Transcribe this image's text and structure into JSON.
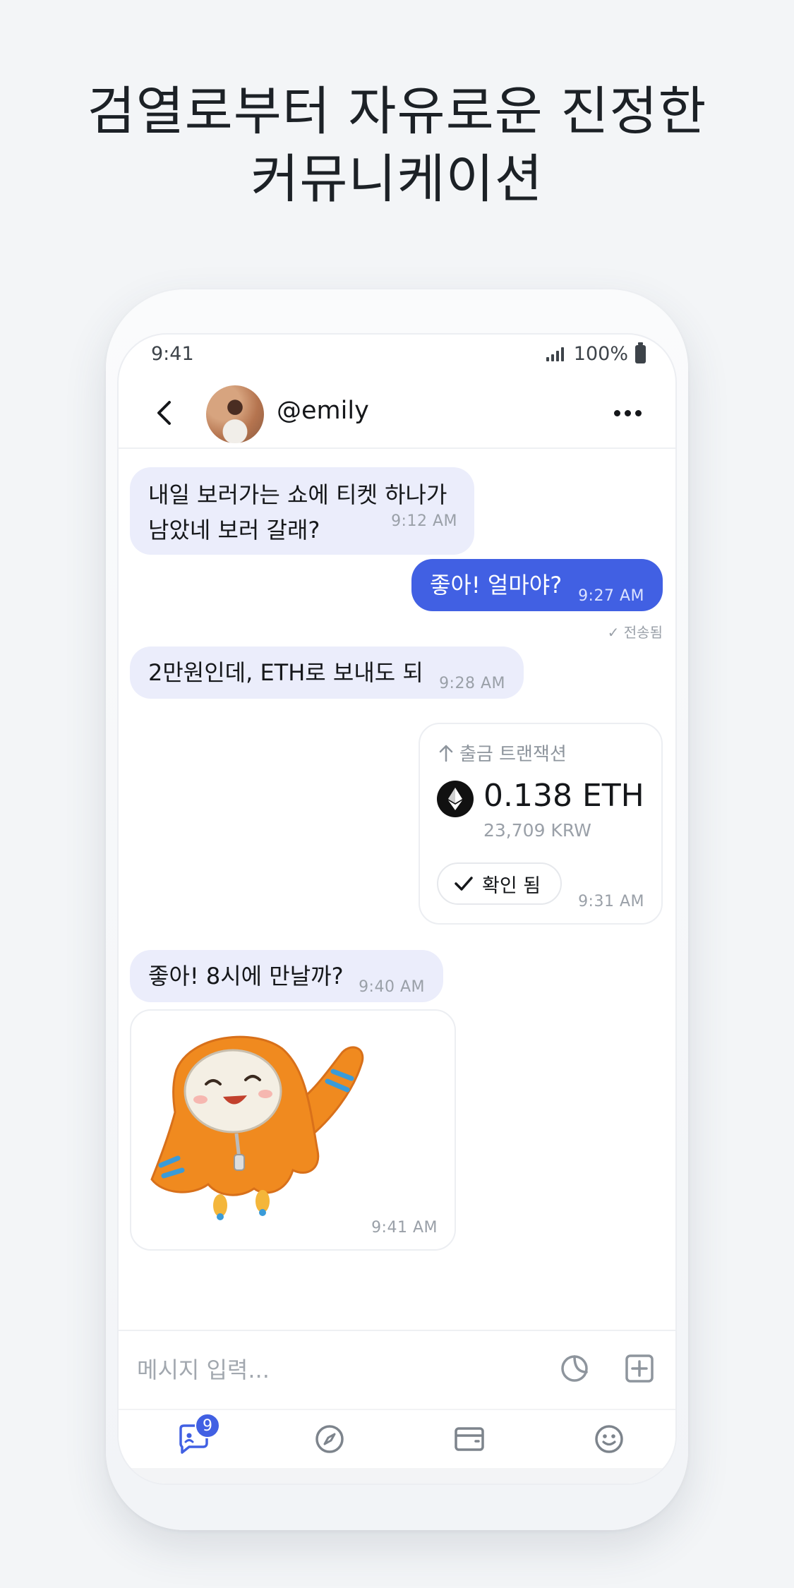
{
  "headline": {
    "line1": "검열로부터 자유로운 진정한",
    "line2": "커뮤니케이션"
  },
  "status_bar": {
    "time": "9:41",
    "battery": "100%"
  },
  "chat_header": {
    "username": "@emily"
  },
  "messages": [
    {
      "direction": "in",
      "line1": "내일 보러가는 쇼에 티켓 하나가",
      "line2": "남았네 보러 갈래?",
      "time": "9:12 AM"
    },
    {
      "direction": "out",
      "text": "좋아! 얼마야?",
      "time": "9:27 AM",
      "status": "✓ 전송됨"
    },
    {
      "direction": "in",
      "text": "2만원인데, ETH로 보내도 되",
      "time": "9:28 AM"
    },
    {
      "direction": "out",
      "type": "transaction",
      "label": "출금 트랜잭션",
      "amount": "0.138 ETH",
      "fiat": "23,709 KRW",
      "confirm_label": "확인 됨",
      "time": "9:31 AM"
    },
    {
      "direction": "in",
      "text": "좋아! 8시에 만날까?",
      "time": "9:40 AM"
    },
    {
      "direction": "in",
      "type": "sticker",
      "sticker": "orange-hooded-mascot-waving",
      "time": "9:41 AM"
    }
  ],
  "composer": {
    "placeholder": "메시지 입력..."
  },
  "tabbar": {
    "chat_badge": "9",
    "tabs": [
      "chat-icon",
      "compass-icon",
      "wallet-icon",
      "smiley-icon"
    ]
  },
  "colors": {
    "accent": "#4160e3",
    "incoming_bubble": "#ebedfb",
    "page_bg": "#f3f5f7"
  }
}
